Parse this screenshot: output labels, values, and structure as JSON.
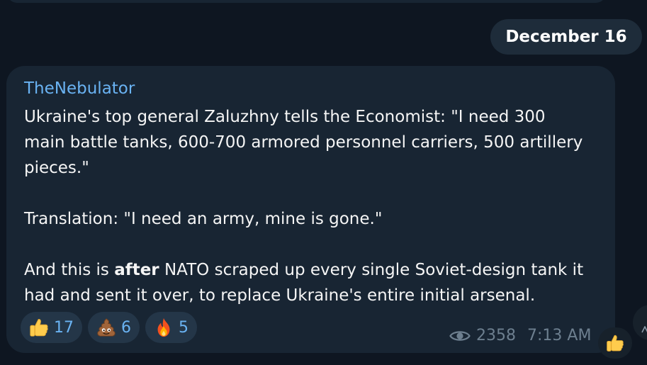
{
  "date_separator": "December 16",
  "message": {
    "author": "TheNebulator",
    "paragraph1": "Ukraine's top general Zaluzhny tells the Economist: \"I need 300 main battle tanks, 600-700 armored personnel carriers, 500 artillery pieces.\"",
    "paragraph2": "Translation: \"I need an army, mine is gone.\"",
    "paragraph3_before": "And this is ",
    "paragraph3_bold": "after",
    "paragraph3_after": " NATO scraped up every single Soviet-design tank it had and sent it over, to replace Ukraine's entire initial arsenal.",
    "reactions": [
      {
        "emoji": "thumbs-up",
        "count": "17"
      },
      {
        "emoji": "pile-of-poo",
        "count": "6"
      },
      {
        "emoji": "fire",
        "count": "5"
      }
    ],
    "views_icon": "eye-icon",
    "views": "2358",
    "time": "7:13 AM"
  },
  "quick_reaction_icon": "thumbs-up-icon",
  "scroll_button_icon": "arrow-icon",
  "colors": {
    "background": "#0e1621",
    "bubble": "#182533",
    "accent": "#6ab3f3",
    "reaction_bg": "#243648",
    "meta_text": "#6d7f8f"
  }
}
